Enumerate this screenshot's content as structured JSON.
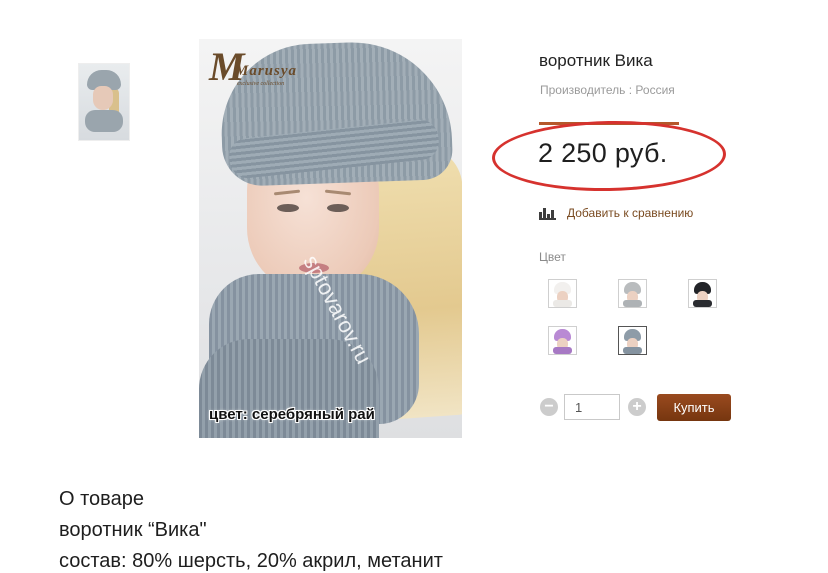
{
  "product": {
    "title": "воротник Вика",
    "manufacturer": "Производитель : Россия",
    "price": "2 250 руб.",
    "compare_label": "Добавить к сравнению",
    "color_label": "Цвет",
    "quantity": "1",
    "buy_label": "Купить",
    "accent_color": "#b5582b",
    "highlight_color": "#d6322e"
  },
  "image": {
    "brand": "Marusya",
    "brand_sub": "exclusive collection",
    "watermark": "sptovarov.ru",
    "caption": "цвет: серебряный рай"
  },
  "swatches": [
    {
      "name": "white",
      "hat": "#f2f0ee",
      "scarf": "#ebe9e6"
    },
    {
      "name": "grey",
      "hat": "#b9bcbe",
      "scarf": "#aeb2b5"
    },
    {
      "name": "black",
      "hat": "#222428",
      "scarf": "#2a2c30"
    },
    {
      "name": "lilac",
      "hat": "#b98ad4",
      "scarf": "#a779c4"
    },
    {
      "name": "silver",
      "hat": "#8e9ca8",
      "scarf": "#8593a0"
    }
  ],
  "description": {
    "heading": "О товаре",
    "line1": "воротник “Вика\"",
    "line2": "состав: 80% шерсть, 20% акрил, метанит"
  }
}
